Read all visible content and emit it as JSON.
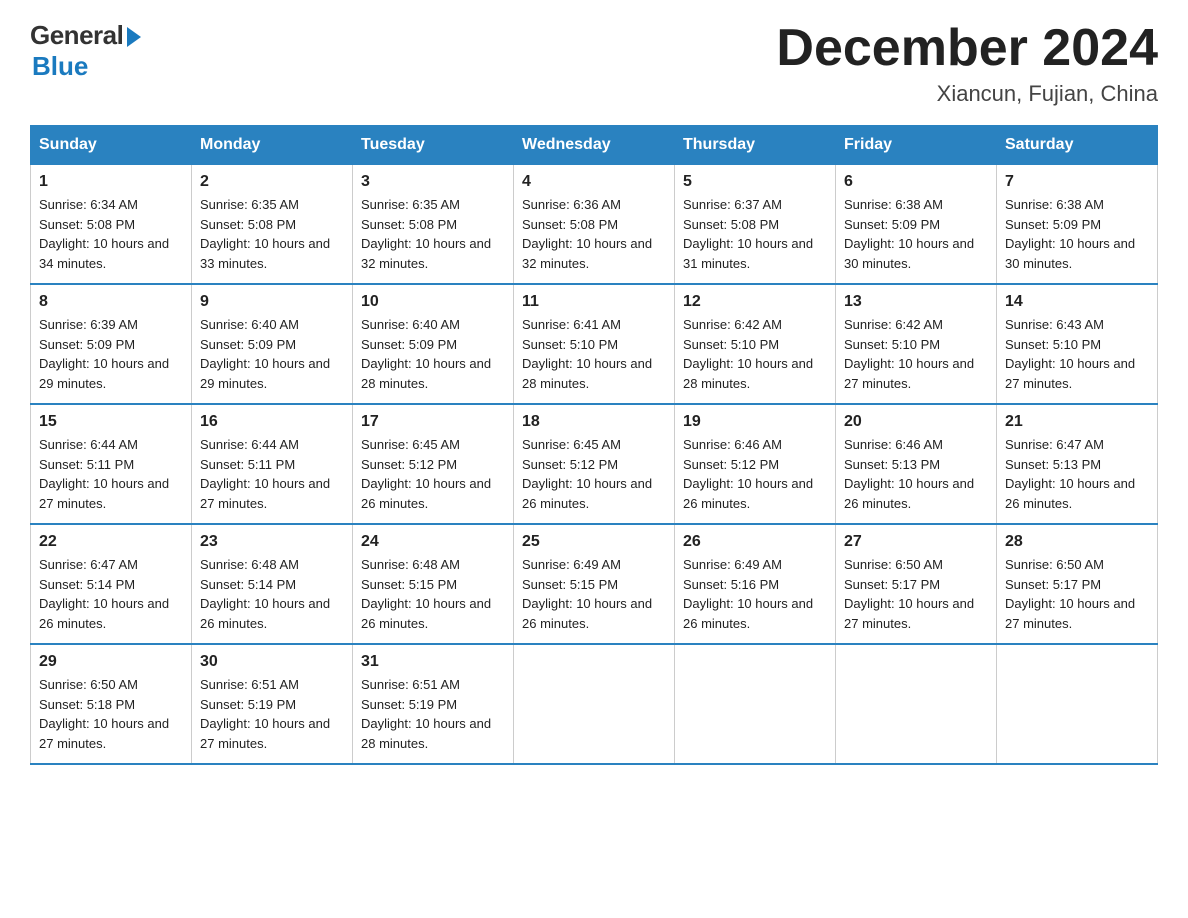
{
  "logo": {
    "general": "General",
    "blue": "Blue"
  },
  "title": "December 2024",
  "subtitle": "Xiancun, Fujian, China",
  "headers": [
    "Sunday",
    "Monday",
    "Tuesday",
    "Wednesday",
    "Thursday",
    "Friday",
    "Saturday"
  ],
  "weeks": [
    [
      {
        "day": "1",
        "sunrise": "6:34 AM",
        "sunset": "5:08 PM",
        "daylight": "10 hours and 34 minutes."
      },
      {
        "day": "2",
        "sunrise": "6:35 AM",
        "sunset": "5:08 PM",
        "daylight": "10 hours and 33 minutes."
      },
      {
        "day": "3",
        "sunrise": "6:35 AM",
        "sunset": "5:08 PM",
        "daylight": "10 hours and 32 minutes."
      },
      {
        "day": "4",
        "sunrise": "6:36 AM",
        "sunset": "5:08 PM",
        "daylight": "10 hours and 32 minutes."
      },
      {
        "day": "5",
        "sunrise": "6:37 AM",
        "sunset": "5:08 PM",
        "daylight": "10 hours and 31 minutes."
      },
      {
        "day": "6",
        "sunrise": "6:38 AM",
        "sunset": "5:09 PM",
        "daylight": "10 hours and 30 minutes."
      },
      {
        "day": "7",
        "sunrise": "6:38 AM",
        "sunset": "5:09 PM",
        "daylight": "10 hours and 30 minutes."
      }
    ],
    [
      {
        "day": "8",
        "sunrise": "6:39 AM",
        "sunset": "5:09 PM",
        "daylight": "10 hours and 29 minutes."
      },
      {
        "day": "9",
        "sunrise": "6:40 AM",
        "sunset": "5:09 PM",
        "daylight": "10 hours and 29 minutes."
      },
      {
        "day": "10",
        "sunrise": "6:40 AM",
        "sunset": "5:09 PM",
        "daylight": "10 hours and 28 minutes."
      },
      {
        "day": "11",
        "sunrise": "6:41 AM",
        "sunset": "5:10 PM",
        "daylight": "10 hours and 28 minutes."
      },
      {
        "day": "12",
        "sunrise": "6:42 AM",
        "sunset": "5:10 PM",
        "daylight": "10 hours and 28 minutes."
      },
      {
        "day": "13",
        "sunrise": "6:42 AM",
        "sunset": "5:10 PM",
        "daylight": "10 hours and 27 minutes."
      },
      {
        "day": "14",
        "sunrise": "6:43 AM",
        "sunset": "5:10 PM",
        "daylight": "10 hours and 27 minutes."
      }
    ],
    [
      {
        "day": "15",
        "sunrise": "6:44 AM",
        "sunset": "5:11 PM",
        "daylight": "10 hours and 27 minutes."
      },
      {
        "day": "16",
        "sunrise": "6:44 AM",
        "sunset": "5:11 PM",
        "daylight": "10 hours and 27 minutes."
      },
      {
        "day": "17",
        "sunrise": "6:45 AM",
        "sunset": "5:12 PM",
        "daylight": "10 hours and 26 minutes."
      },
      {
        "day": "18",
        "sunrise": "6:45 AM",
        "sunset": "5:12 PM",
        "daylight": "10 hours and 26 minutes."
      },
      {
        "day": "19",
        "sunrise": "6:46 AM",
        "sunset": "5:12 PM",
        "daylight": "10 hours and 26 minutes."
      },
      {
        "day": "20",
        "sunrise": "6:46 AM",
        "sunset": "5:13 PM",
        "daylight": "10 hours and 26 minutes."
      },
      {
        "day": "21",
        "sunrise": "6:47 AM",
        "sunset": "5:13 PM",
        "daylight": "10 hours and 26 minutes."
      }
    ],
    [
      {
        "day": "22",
        "sunrise": "6:47 AM",
        "sunset": "5:14 PM",
        "daylight": "10 hours and 26 minutes."
      },
      {
        "day": "23",
        "sunrise": "6:48 AM",
        "sunset": "5:14 PM",
        "daylight": "10 hours and 26 minutes."
      },
      {
        "day": "24",
        "sunrise": "6:48 AM",
        "sunset": "5:15 PM",
        "daylight": "10 hours and 26 minutes."
      },
      {
        "day": "25",
        "sunrise": "6:49 AM",
        "sunset": "5:15 PM",
        "daylight": "10 hours and 26 minutes."
      },
      {
        "day": "26",
        "sunrise": "6:49 AM",
        "sunset": "5:16 PM",
        "daylight": "10 hours and 26 minutes."
      },
      {
        "day": "27",
        "sunrise": "6:50 AM",
        "sunset": "5:17 PM",
        "daylight": "10 hours and 27 minutes."
      },
      {
        "day": "28",
        "sunrise": "6:50 AM",
        "sunset": "5:17 PM",
        "daylight": "10 hours and 27 minutes."
      }
    ],
    [
      {
        "day": "29",
        "sunrise": "6:50 AM",
        "sunset": "5:18 PM",
        "daylight": "10 hours and 27 minutes."
      },
      {
        "day": "30",
        "sunrise": "6:51 AM",
        "sunset": "5:19 PM",
        "daylight": "10 hours and 27 minutes."
      },
      {
        "day": "31",
        "sunrise": "6:51 AM",
        "sunset": "5:19 PM",
        "daylight": "10 hours and 28 minutes."
      },
      null,
      null,
      null,
      null
    ]
  ]
}
